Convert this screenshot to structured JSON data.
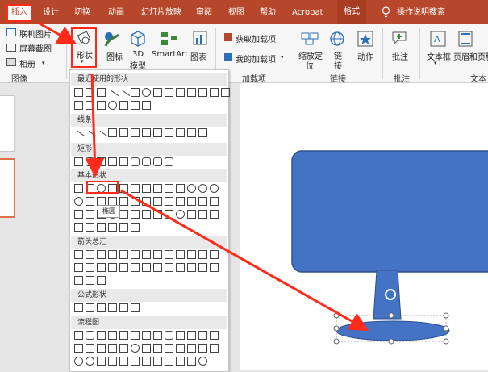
{
  "tabs": [
    {
      "label": "插入",
      "active": true
    },
    {
      "label": "设计"
    },
    {
      "label": "切换"
    },
    {
      "label": "动画"
    },
    {
      "label": "幻灯片放映"
    },
    {
      "label": "审阅"
    },
    {
      "label": "视图"
    },
    {
      "label": "帮助"
    },
    {
      "label": "Acrobat"
    },
    {
      "label": "格式",
      "contextual": true
    }
  ],
  "tell_me": "操作说明搜索",
  "ribbon": {
    "images_group": {
      "online_pictures": "联机图片",
      "screenshot": "屏幕截图",
      "album": "相册",
      "label": "图像"
    },
    "illustrations": {
      "shapes": "形状",
      "icons": "图标",
      "model_3d_line1": "3D",
      "model_3d_line2": "模型",
      "smartart": "SmartArt",
      "chart": "图表"
    },
    "addins": {
      "get_addins": "获取加载项",
      "my_addins": "我的加载项",
      "label": "加载项"
    },
    "links": {
      "zoom_line1": "缩放定",
      "zoom_line2": "位",
      "link_line1": "链",
      "link_line2": "接",
      "action": "动作",
      "label": "链接"
    },
    "comments": {
      "comment": "批注",
      "label": "批注"
    },
    "text": {
      "textbox_line1": "文本框",
      "header_footer": "页眉和页脚",
      "label": "文本"
    }
  },
  "shapes_menu": {
    "sections": [
      "最近使用的形状",
      "线条",
      "矩形",
      "基本形状",
      "箭头总汇",
      "公式形状",
      "流程图"
    ],
    "tooltip": "椭圆"
  },
  "colors": {
    "accent": "#b7472a",
    "highlight": "#ff2a1a",
    "shape_fill": "#4472c4",
    "shape_stroke": "#2f528f"
  }
}
